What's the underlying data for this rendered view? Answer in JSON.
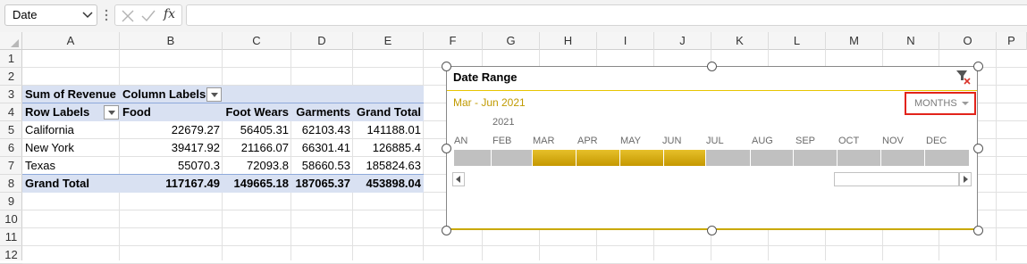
{
  "formula_bar": {
    "name_box_value": "Date",
    "function_label": "fx",
    "formula_value": ""
  },
  "columns": [
    "A",
    "B",
    "C",
    "D",
    "E",
    "F",
    "G",
    "H",
    "I",
    "J",
    "K",
    "L",
    "M",
    "N",
    "O",
    "P"
  ],
  "rows": [
    "1",
    "2",
    "3",
    "4",
    "5",
    "6",
    "7",
    "8",
    "9",
    "10",
    "11",
    "12"
  ],
  "pivot": {
    "title": "Sum of Revenue",
    "column_labels": "Column Labels",
    "row_labels": "Row Labels",
    "headers": [
      "Food",
      "Foot Wears",
      "Garments",
      "Grand Total"
    ],
    "rows": [
      {
        "label": "California",
        "values": [
          "22679.27",
          "56405.31",
          "62103.43",
          "141188.01"
        ]
      },
      {
        "label": "New York",
        "values": [
          "39417.92",
          "21166.07",
          "66301.41",
          "126885.4"
        ]
      },
      {
        "label": "Texas",
        "values": [
          "55070.3",
          "72093.8",
          "58660.53",
          "185824.63"
        ]
      }
    ],
    "total": {
      "label": "Grand Total",
      "values": [
        "117167.49",
        "149665.18",
        "187065.37",
        "453898.04"
      ]
    },
    "band_color": "#d9e1f2"
  },
  "timeline": {
    "title": "Date Range",
    "range_label": "Mar - Jun 2021",
    "level_label": "MONTHS",
    "year_label": "2021",
    "months": [
      "AN",
      "FEB",
      "MAR",
      "APR",
      "MAY",
      "JUN",
      "JUL",
      "AUG",
      "SEP",
      "OCT",
      "NOV",
      "DEC"
    ],
    "selected_months": [
      "MAR",
      "APR",
      "MAY",
      "JUN"
    ],
    "accent_color": "#c59800",
    "highlight_color": "#e2231a",
    "icons": {
      "clear_filter": "clear-filter-icon",
      "scroll_left": "scroll-left-icon",
      "scroll_right": "scroll-right-icon"
    }
  }
}
